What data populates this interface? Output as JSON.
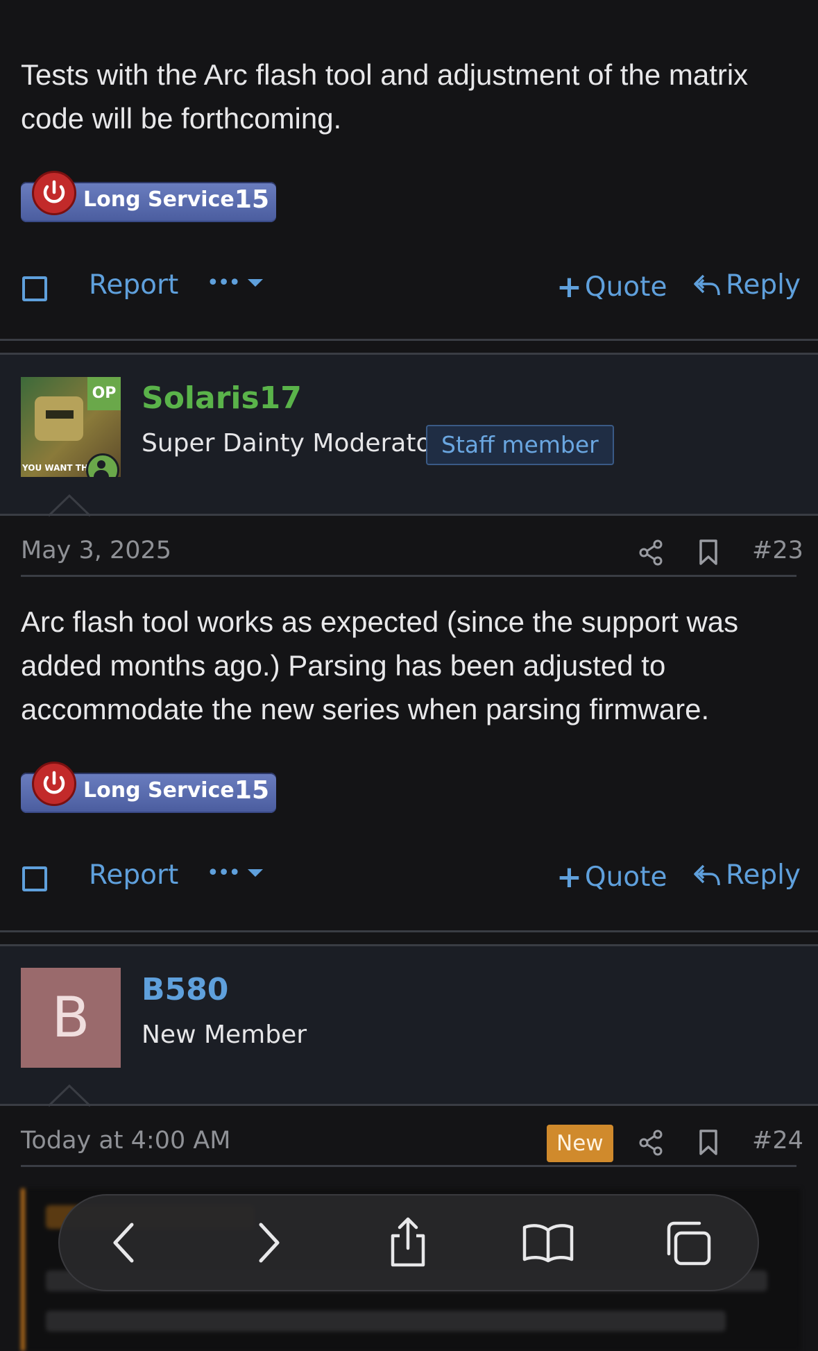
{
  "post22": {
    "body": "Tests with the Arc flash tool and adjustment of the matrix code will be forthcoming.",
    "badge": {
      "label": "Long Service",
      "number": "15"
    },
    "actions": {
      "report": "Report",
      "more": "•••",
      "quote": "Quote",
      "reply": "Reply"
    }
  },
  "post23": {
    "author": "Solaris17",
    "op_label": "OP",
    "avatar_caption": "YOU WANT THE",
    "user_title": "Super Dainty Moderator",
    "staff_label": "Staff member",
    "date": "May 3, 2025",
    "number": "#23",
    "body": "Arc flash tool works as expected (since the support was added months ago.) Parsing has been adjusted to accommodate the new series when parsing firmware.",
    "badge": {
      "label": "Long Service",
      "number": "15"
    },
    "actions": {
      "report": "Report",
      "more": "•••",
      "quote": "Quote",
      "reply": "Reply"
    }
  },
  "post24": {
    "author": "B580",
    "avatar_letter": "B",
    "user_title": "New Member",
    "date": "Today at 4:00 AM",
    "new_label": "New",
    "number": "#24"
  },
  "colors": {
    "link": "#5fa0dc",
    "op_green": "#5ab34a",
    "new_badge": "#d08a2c",
    "avatar_b": "#9a6a6c"
  },
  "browser_toolbar": {
    "icons": [
      "back-icon",
      "forward-icon",
      "share-icon",
      "bookmarks-icon",
      "tabs-icon"
    ]
  }
}
